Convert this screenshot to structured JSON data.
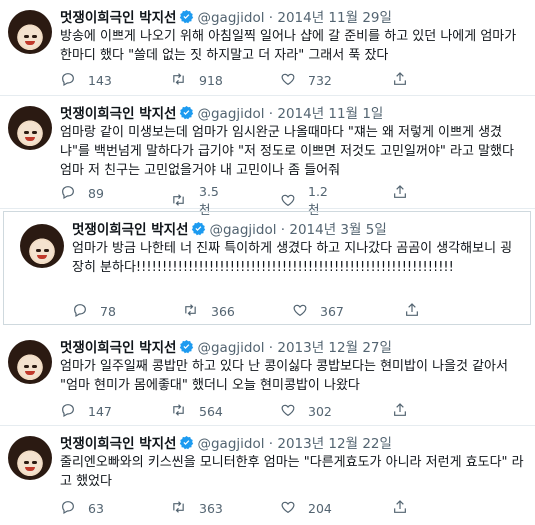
{
  "user": {
    "name": "멋쟁이희극인 박지선",
    "handle": "@gagjidol"
  },
  "tweets": [
    {
      "date": "2014년 11월 29일",
      "text": "방송에 이쁘게 나오기 위해 아침일찍 일어나 샵에 갈 준비를 하고 있던 나에게 엄마가 한마디 했다 \"쓸데 없는 짓 하지말고 더 자라\" 그래서 푹 잤다",
      "replies": "143",
      "retweets": "918",
      "likes": "732"
    },
    {
      "date": "2014년 11월 1일",
      "text": "엄마랑 같이 미생보는데 엄마가 임시완군 나올때마다 \"쟤는 왜 저렇게 이쁘게 생겼냐\"를 백번넘게 말하다가 급기야 \"저 정도로 이쁘면 저것도 고민일꺼야\" 라고 말했다 엄마 저 친구는 고민없을거야 내 고민이나 좀 들어줘",
      "replies": "89",
      "retweets": "3.5천",
      "likes": "1.2천"
    },
    {
      "date": "2014년 3월 5일",
      "text": "엄마가 방금 나한테 너 진짜 특이하게 생겼다 하고 지나갔다 곰곰이 생각해보니 굉장히 분하다!!!!!!!!!!!!!!!!!!!!!!!!!!!!!!!!!!!!!!!!!!!!!!!!!!!!!!!!!!!!!",
      "replies": "78",
      "retweets": "366",
      "likes": "367"
    },
    {
      "date": "2013년 12월 27일",
      "text": "엄마가 일주일째 콩밥만 하고 있다 난 콩이싫다 콩밥보다는 현미밥이 나을것 같아서 \"엄마 현미가 몸에좋대\" 했더니 오늘 현미콩밥이 나왔다",
      "replies": "147",
      "retweets": "564",
      "likes": "302"
    },
    {
      "date": "2013년 12월 22일",
      "text": "줄리엔오빠와의 키스씬을 모니터한후 엄마는 \"다른게효도가 아니라 저런게 효도다\" 라고 했었다",
      "replies": "63",
      "retweets": "363",
      "likes": "204"
    }
  ],
  "icons": {
    "reply": "reply-icon",
    "retweet": "retweet-icon",
    "like": "heart-icon",
    "share": "share-icon",
    "verified": "verified-badge-icon"
  },
  "colors": {
    "verified": "#1d9bf0",
    "meta": "#536471",
    "divider": "#e6ecf0"
  }
}
